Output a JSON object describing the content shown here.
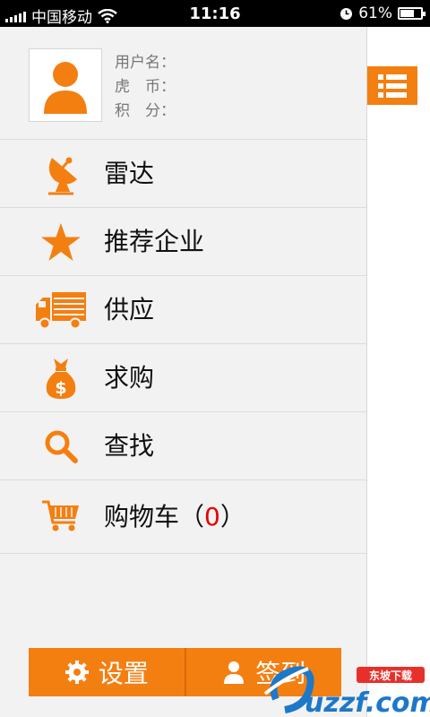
{
  "status_bar": {
    "carrier": "中国移动",
    "time": "11:16",
    "battery": "61%",
    "battery_level": 0.61
  },
  "profile": {
    "username_label": "用户名：",
    "coins_label": "虎　币：",
    "points_label": "积　分："
  },
  "menu": {
    "items": [
      {
        "label": "雷达",
        "icon": "radar-dish-icon"
      },
      {
        "label": "推荐企业",
        "icon": "star-icon"
      },
      {
        "label": "供应",
        "icon": "truck-icon"
      },
      {
        "label": "求购",
        "icon": "money-bag-icon"
      },
      {
        "label": "查找",
        "icon": "search-icon"
      }
    ],
    "cart": {
      "label": "购物车（",
      "count": "0",
      "suffix": "）",
      "icon": "shopping-cart-icon"
    }
  },
  "bottom_bar": {
    "settings_label": "设置",
    "signin_label": "签到"
  },
  "watermark": {
    "brand": "uzzf.com",
    "tagline": "东坡下载"
  },
  "colors": {
    "accent": "#f47f11",
    "drawer_bg": "#f2f2f2",
    "cart_count": "#e60000"
  }
}
